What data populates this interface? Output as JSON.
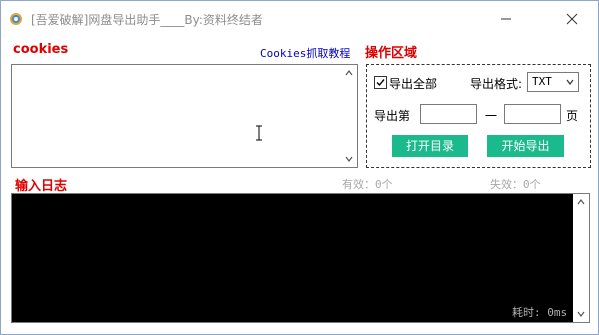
{
  "window": {
    "title": "[吾爱破解]网盘导出助手____By:资料终结者",
    "icon": "app-gear-icon"
  },
  "cookies": {
    "heading": "cookies",
    "tutorial_link": "Cookies抓取教程",
    "value": ""
  },
  "ops": {
    "heading": "操作区域",
    "export_all_label": "导出全部",
    "export_all_checked": true,
    "format_label": "导出格式:",
    "format_value": "TXT",
    "range_label": "导出第",
    "range_from": "",
    "range_dash": "一",
    "range_to": "",
    "page_suffix": "页",
    "open_dir_button": "打开目录",
    "start_export_button": "开始导出"
  },
  "log": {
    "heading": "输入日志",
    "valid_text": "有效：0个",
    "invalid_text": "失效：0个",
    "elapsed_text": "耗时: 0ms"
  },
  "colors": {
    "accent_red": "#e00000",
    "button_green": "#1aba8c",
    "link_blue": "#0000c8"
  }
}
